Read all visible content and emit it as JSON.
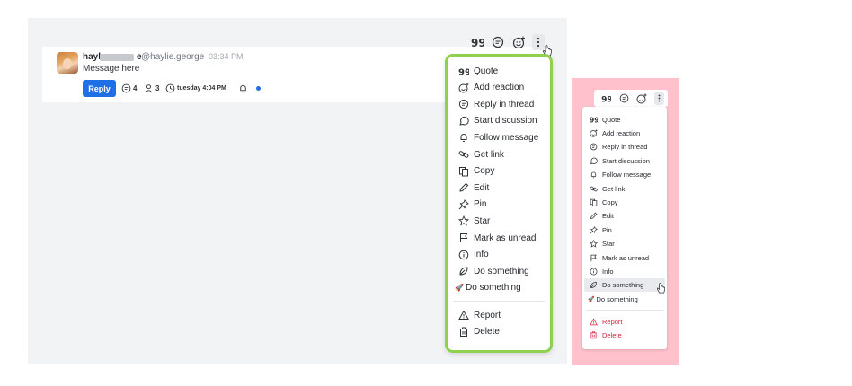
{
  "message": {
    "name_prefix": "hayl",
    "name_suffix": "e",
    "handle": "@haylie.george",
    "time": "03:34 PM",
    "body": "Message here",
    "reply_label": "Reply",
    "thread_count": "4",
    "member_count": "3",
    "reminder": "tuesday 4:04 PM"
  },
  "menu": {
    "items": [
      {
        "label": "Quote",
        "icon": "quote-icon"
      },
      {
        "label": "Add reaction",
        "icon": "add-reaction-icon"
      },
      {
        "label": "Reply in thread",
        "icon": "reply-thread-icon"
      },
      {
        "label": "Start discussion",
        "icon": "discussion-icon"
      },
      {
        "label": "Follow message",
        "icon": "bell-icon"
      },
      {
        "label": "Get link",
        "icon": "link-icon"
      },
      {
        "label": "Copy",
        "icon": "copy-icon"
      },
      {
        "label": "Edit",
        "icon": "pencil-icon"
      },
      {
        "label": "Pin",
        "icon": "pin-icon"
      },
      {
        "label": "Star",
        "icon": "star-icon"
      },
      {
        "label": "Mark as unread",
        "icon": "flag-icon"
      },
      {
        "label": "Info",
        "icon": "info-icon"
      },
      {
        "label": "Do something",
        "icon": "leaf-icon"
      },
      {
        "label": "Do something",
        "icon": "rocket-emoji"
      }
    ],
    "danger": [
      {
        "label": "Report",
        "icon": "warning-icon"
      },
      {
        "label": "Delete",
        "icon": "trash-icon"
      }
    ],
    "rocket": "🚀"
  },
  "colors": {
    "accent": "#1f6fe5",
    "highlight_border": "#8fd14f",
    "mock_background": "#ffc1cc",
    "danger": "#d0243c"
  }
}
